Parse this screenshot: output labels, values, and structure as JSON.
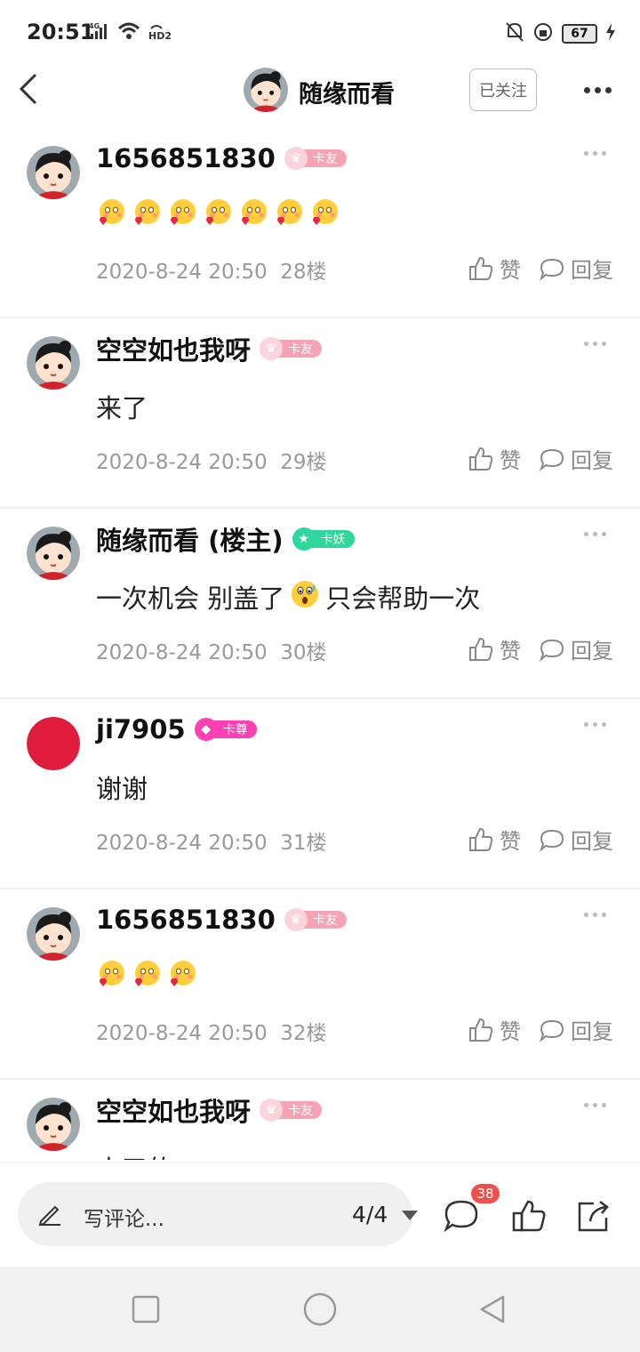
{
  "status_bar": {
    "time": "20:51",
    "network": "4G",
    "hd": "HD2",
    "battery": "67",
    "icons": [
      "signal-icon",
      "wifi-icon",
      "hd-icon",
      "bell-off-icon",
      "rotation-lock-icon",
      "battery-icon",
      "charging-icon"
    ]
  },
  "header": {
    "title": "随缘而看",
    "follow_label": "已关注"
  },
  "comments": [
    {
      "name": "1656851830",
      "badge": "卡友",
      "badge_type": "friend",
      "text": "",
      "emoji_count": 7,
      "emoji": "love-face",
      "date": "2020-8-24 20:50",
      "floor": "28楼",
      "avatar": "girl"
    },
    {
      "name": "空空如也我呀",
      "badge": "卡友",
      "badge_type": "friend",
      "text": "来了",
      "emoji_count": 0,
      "emoji": "",
      "date": "2020-8-24 20:50",
      "floor": "29楼",
      "avatar": "girl"
    },
    {
      "name": "随缘而看 (楼主)",
      "badge": "卡妖",
      "badge_type": "yao",
      "text": "一次机会 别盖了",
      "text_after": "只会帮助一次",
      "inline_emoji": "shocked-face",
      "date": "2020-8-24 20:50",
      "floor": "30楼",
      "avatar": "girl"
    },
    {
      "name": "ji7905",
      "badge": "卡尊",
      "badge_type": "zun",
      "text": "谢谢",
      "emoji_count": 0,
      "emoji": "",
      "date": "2020-8-24 20:50",
      "floor": "31楼",
      "avatar": "red"
    },
    {
      "name": "1656851830",
      "badge": "卡友",
      "badge_type": "friend",
      "text": "",
      "emoji_count": 3,
      "emoji": "love-face",
      "date": "2020-8-24 20:50",
      "floor": "32楼",
      "avatar": "girl"
    },
    {
      "name": "空空如也我呀",
      "badge": "卡友",
      "badge_type": "friend",
      "text": "来了的",
      "emoji_count": 0,
      "emoji": "",
      "date": "",
      "floor": "",
      "avatar": "girl"
    }
  ],
  "actions": {
    "like_label": "赞",
    "reply_label": "回复"
  },
  "bottom_bar": {
    "write_placeholder": "写评论...",
    "page_indicator": "4/4",
    "comment_count": "38"
  },
  "colors": {
    "badge_friend": "#f7a3b6",
    "badge_yao": "#2fd79b",
    "badge_zun": "#ff3fb4",
    "red_avatar": "#e01c3c",
    "count_badge": "#f0504a"
  }
}
